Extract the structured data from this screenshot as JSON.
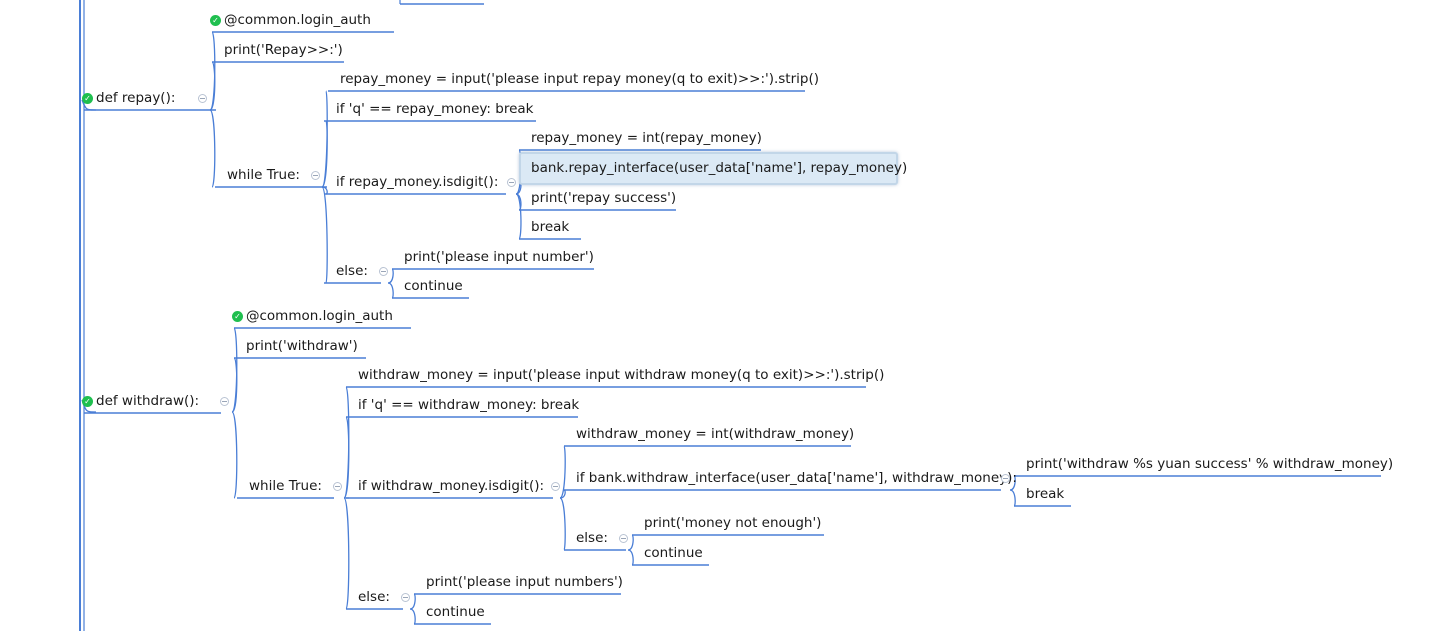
{
  "colors": {
    "line": "#4a7ed6",
    "check": "#1fbf4f",
    "selected_bg": "#dbe9f5"
  },
  "nodes": {
    "repay_login_auth": "@common.login_auth",
    "repay_print": "print('Repay>>:')",
    "repay_def": "def repay():",
    "repay_input": "repay_money = input('please input repay money(q to exit)>>:').strip()",
    "repay_if_q": "if 'q' == repay_money: break",
    "repay_int": "repay_money = int(repay_money)",
    "repay_interface": "bank.repay_interface(user_data['name'], repay_money)",
    "repay_while": "while True:",
    "repay_isdigit": "if repay_money.isdigit():",
    "repay_success": "print('repay success')",
    "repay_break": "break",
    "repay_print_number": "print('please input number')",
    "repay_else": "else:",
    "repay_continue": "continue",
    "withdraw_login_auth": "@common.login_auth",
    "withdraw_print": "print('withdraw')",
    "withdraw_input": "withdraw_money = input('please input withdraw money(q to exit)>>:').strip()",
    "withdraw_def": "def withdraw():",
    "withdraw_if_q": "if 'q' == withdraw_money: break",
    "withdraw_int": "withdraw_money = int(withdraw_money)",
    "withdraw_print_success": "print('withdraw %s yuan success' % withdraw_money)",
    "withdraw_if_interface": "if bank.withdraw_interface(user_data['name'], withdraw_money):",
    "withdraw_while": "while True:",
    "withdraw_isdigit": "if withdraw_money.isdigit():",
    "withdraw_break": "break",
    "withdraw_not_enough": "print('money not enough')",
    "withdraw_inner_else": "else:",
    "withdraw_inner_continue": "continue",
    "withdraw_print_numbers": "print('please input numbers')",
    "withdraw_else": "else:",
    "withdraw_continue": "continue"
  }
}
